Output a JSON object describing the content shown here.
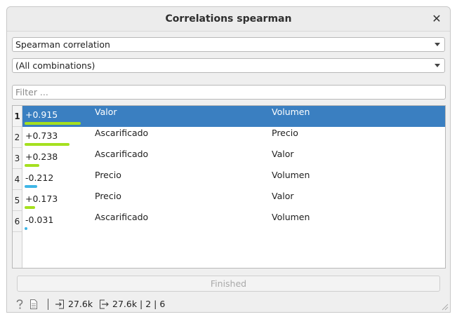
{
  "window": {
    "title": "Correlations spearman"
  },
  "controls": {
    "correlation_type": "Spearman correlation",
    "combinations": "(All combinations)",
    "filter_placeholder": "Filter ..."
  },
  "table": {
    "rows": [
      {
        "index": "1",
        "value": "+0.915",
        "magnitude": 0.915,
        "sign": "positive",
        "attr1": "Valor",
        "attr2": "Volumen",
        "selected": true
      },
      {
        "index": "2",
        "value": "+0.733",
        "magnitude": 0.733,
        "sign": "positive",
        "attr1": "Ascarificado",
        "attr2": "Precio",
        "selected": false
      },
      {
        "index": "3",
        "value": "+0.238",
        "magnitude": 0.238,
        "sign": "positive",
        "attr1": "Ascarificado",
        "attr2": "Valor",
        "selected": false
      },
      {
        "index": "4",
        "value": "-0.212",
        "magnitude": 0.212,
        "sign": "negative",
        "attr1": "Precio",
        "attr2": "Volumen",
        "selected": false
      },
      {
        "index": "5",
        "value": "+0.173",
        "magnitude": 0.173,
        "sign": "positive",
        "attr1": "Precio",
        "attr2": "Valor",
        "selected": false
      },
      {
        "index": "6",
        "value": "-0.031",
        "magnitude": 0.031,
        "sign": "negative",
        "attr1": "Ascarificado",
        "attr2": "Volumen",
        "selected": false
      }
    ]
  },
  "progress": {
    "label": "Finished"
  },
  "status": {
    "input_size": "27.6k",
    "output_summary": "27.6k | 2 | 6"
  },
  "icons": {
    "help": "help-icon",
    "report": "report-icon",
    "input": "input-icon",
    "output": "output-icon"
  },
  "colors": {
    "positive_bar": "#a5e01f",
    "negative_bar": "#3fb6e6",
    "selection": "#3a7fc1"
  }
}
